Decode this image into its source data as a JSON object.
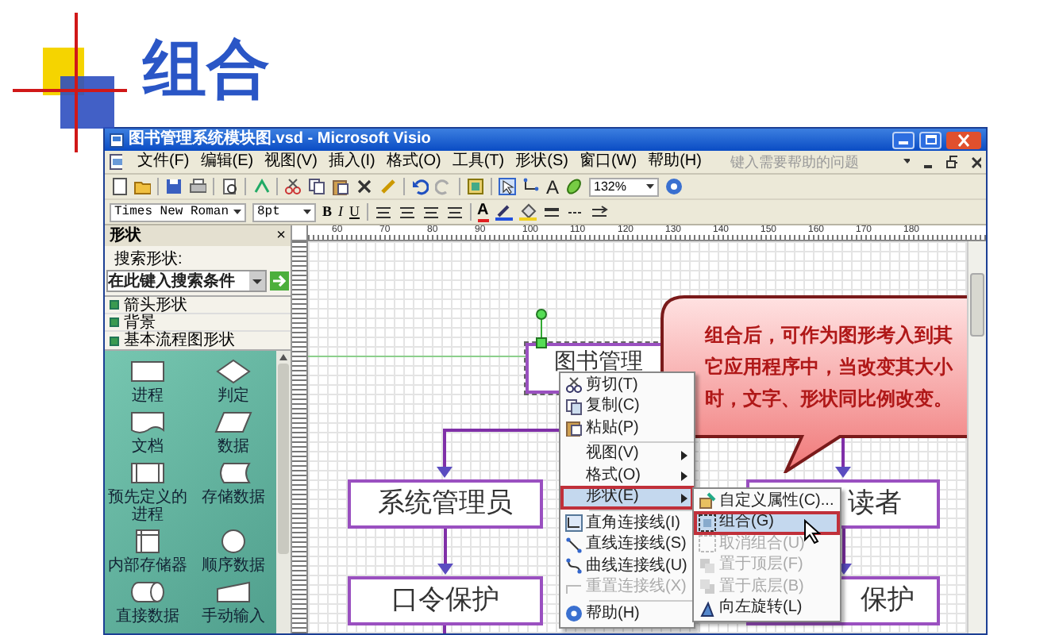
{
  "slide": {
    "title": "组合"
  },
  "window": {
    "title": "图书管理系统模块图.vsd - Microsoft Visio",
    "help_placeholder": "键入需要帮助的问题",
    "menu": [
      "文件(F)",
      "编辑(E)",
      "视图(V)",
      "插入(I)",
      "格式(O)",
      "工具(T)",
      "形状(S)",
      "窗口(W)",
      "帮助(H)"
    ]
  },
  "toolbar": {
    "zoom": "132%",
    "text_tool": "A",
    "font": "Times New Roman",
    "font_size": "8pt",
    "bold": "B",
    "italic": "I",
    "underline": "U",
    "color_letter": "A"
  },
  "shapes_panel": {
    "title": "形状",
    "close": "×",
    "search_label": "搜索形状:",
    "search_placeholder": "在此键入搜索条件",
    "categories": [
      "箭头形状",
      "背景",
      "基本流程图形状"
    ],
    "stencils": [
      {
        "label": "进程",
        "kind": "process"
      },
      {
        "label": "判定",
        "kind": "decision"
      },
      {
        "label": "文档",
        "kind": "document"
      },
      {
        "label": "数据",
        "kind": "data"
      },
      {
        "label": "预先定义的进程",
        "kind": "predefined"
      },
      {
        "label": "存储数据",
        "kind": "stored"
      },
      {
        "label": "内部存储器",
        "kind": "internal"
      },
      {
        "label": "顺序数据",
        "kind": "sequential"
      },
      {
        "label": "直接数据",
        "kind": "direct"
      },
      {
        "label": "手动输入",
        "kind": "manual"
      }
    ]
  },
  "ruler": {
    "labels": [
      "60",
      "70",
      "80",
      "90",
      "100",
      "110",
      "120",
      "130",
      "140",
      "150",
      "160",
      "170",
      "180"
    ]
  },
  "diagram": {
    "boxes": [
      {
        "text": "图书管理",
        "selected": true
      },
      {
        "text": "系统管理员",
        "selected": false
      },
      {
        "text": "口令保护",
        "selected": false
      },
      {
        "text": "读者",
        "selected": false
      },
      {
        "text": "保护",
        "selected": false
      }
    ]
  },
  "context_menu": {
    "items": [
      {
        "kind": "item",
        "label": "剪切(T)",
        "submenu": false,
        "disabled": false,
        "selected": false
      },
      {
        "kind": "item",
        "label": "复制(C)",
        "submenu": false,
        "disabled": false,
        "selected": false
      },
      {
        "kind": "item",
        "label": "粘贴(P)",
        "submenu": false,
        "disabled": false,
        "selected": false
      },
      {
        "kind": "separator"
      },
      {
        "kind": "item",
        "label": "视图(V)",
        "submenu": true,
        "disabled": false,
        "selected": false
      },
      {
        "kind": "item",
        "label": "格式(O)",
        "submenu": true,
        "disabled": false,
        "selected": false
      },
      {
        "kind": "item",
        "label": "形状(E)",
        "submenu": true,
        "disabled": false,
        "selected": true
      },
      {
        "kind": "separator"
      },
      {
        "kind": "item",
        "label": "直角连接线(I)",
        "submenu": false,
        "disabled": false,
        "selected": false
      },
      {
        "kind": "item",
        "label": "直线连接线(S)",
        "submenu": false,
        "disabled": false,
        "selected": false
      },
      {
        "kind": "item",
        "label": "曲线连接线(U)",
        "submenu": false,
        "disabled": false,
        "selected": false
      },
      {
        "kind": "item",
        "label": "重置连接线(X)",
        "submenu": false,
        "disabled": true,
        "selected": false
      },
      {
        "kind": "separator"
      },
      {
        "kind": "item",
        "label": "帮助(H)",
        "submenu": false,
        "disabled": false,
        "selected": false
      }
    ]
  },
  "submenu": {
    "items": [
      {
        "label": "自定义属性(C)...",
        "disabled": false,
        "selected": false
      },
      {
        "label": "组合(G)",
        "disabled": false,
        "selected": true
      },
      {
        "label": "取消组合(U)",
        "disabled": true,
        "selected": false
      },
      {
        "label": "置于顶层(F)",
        "disabled": true,
        "selected": false
      },
      {
        "label": "置于底层(B)",
        "disabled": true,
        "selected": false
      },
      {
        "label": "向左旋转(L)",
        "disabled": false,
        "selected": false
      }
    ]
  },
  "callout": {
    "text": "组合后，可作为图形考入到其它应用程序中，当改变其大小时，文字、形状同比例改变。"
  }
}
